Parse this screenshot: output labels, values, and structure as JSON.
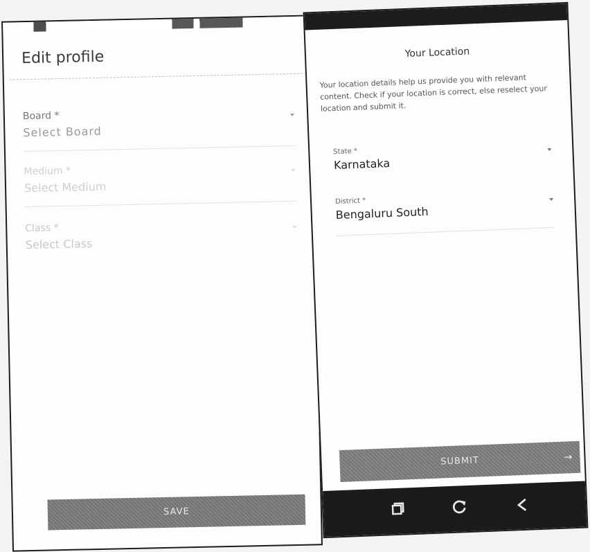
{
  "left_screen": {
    "title": "Edit profile",
    "fields": [
      {
        "label": "Board *",
        "value": "Select Board"
      },
      {
        "label": "Medium *",
        "value": "Select Medium"
      },
      {
        "label": "Class *",
        "value": "Select Class"
      }
    ],
    "save_label": "SAVE"
  },
  "right_screen": {
    "status_left": "",
    "status_right": "",
    "title": "Your Location",
    "description": "Your location details help us provide you with relevant content. Check if your location is correct, else reselect your location and submit it.",
    "fields": [
      {
        "label": "State *",
        "value": "Karnataka"
      },
      {
        "label": "District *",
        "value": "Bengaluru South"
      }
    ],
    "submit_label": "SUBMIT",
    "submit_icon": "arrow-right-icon",
    "nav": [
      "recent-apps-icon",
      "home-icon",
      "back-icon"
    ]
  },
  "colors": {
    "button_gray": "#7b7b7b",
    "nav_bar": "#1b1b1b",
    "text_dark": "#222222"
  }
}
